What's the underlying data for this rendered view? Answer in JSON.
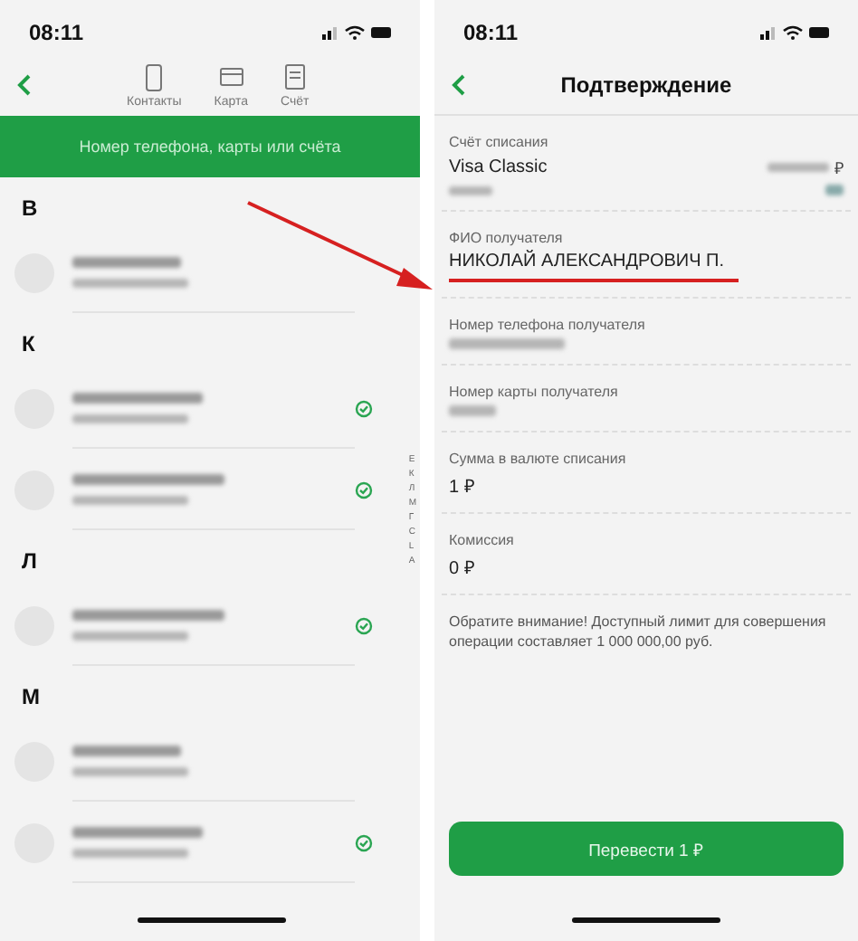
{
  "left": {
    "time": "08:11",
    "tabs": [
      {
        "label": "Контакты",
        "kind": "phone"
      },
      {
        "label": "Карта",
        "kind": "card"
      },
      {
        "label": "Счёт",
        "kind": "doc"
      }
    ],
    "search": {
      "placeholder": "Номер телефона, карты или счёта"
    },
    "sections": [
      {
        "letter": "В",
        "contacts": [
          {
            "verified": false
          }
        ]
      },
      {
        "letter": "К",
        "contacts": [
          {
            "verified": true
          },
          {
            "verified": true
          }
        ]
      },
      {
        "letter": "Л",
        "contacts": [
          {
            "verified": true
          }
        ]
      },
      {
        "letter": "М",
        "contacts": [
          {
            "verified": false
          },
          {
            "verified": true
          }
        ]
      }
    ],
    "index": [
      "Е",
      "К",
      "Л",
      "М",
      "Г",
      "С",
      "L",
      "А"
    ]
  },
  "right": {
    "time": "08:11",
    "title": "Подтверждение",
    "fields": [
      {
        "kind": "account",
        "label": "Счёт списания",
        "value": "Visa Classic",
        "currency": "₽"
      },
      {
        "kind": "plain",
        "label": "ФИО получателя",
        "value": "НИКОЛАЙ АЛЕКСАНДРОВИЧ П.",
        "underlined": true
      },
      {
        "kind": "hidden",
        "label": "Номер телефона получателя"
      },
      {
        "kind": "hidden",
        "label": "Номер карты получателя"
      },
      {
        "kind": "plain",
        "label": "Сумма в валюте списания",
        "value": "1 ₽",
        "underlined": false
      },
      {
        "kind": "plain",
        "label": "Комиссия",
        "value": "0 ₽",
        "underlined": false
      }
    ],
    "notice": "Обратите внимание! Доступный лимит для совершения операции составляет 1 000 000,00 руб.",
    "button": "Перевести 1 ₽"
  }
}
